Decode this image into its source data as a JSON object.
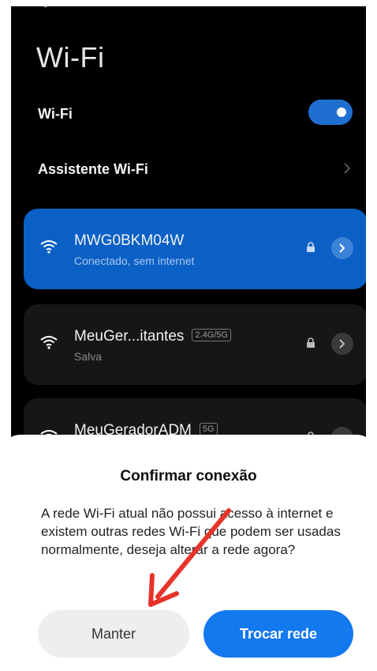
{
  "screen": {
    "title": "Wi-Fi",
    "wifi_toggle": {
      "label": "Wi-Fi",
      "state": "on"
    },
    "assistant": {
      "label": "Assistente Wi-Fi"
    },
    "networks": [
      {
        "name": "MWG0BKM04W",
        "status": "Conectado, sem internet",
        "band": "",
        "secured": true,
        "active": true
      },
      {
        "name": "MeuGer...itantes",
        "status": "Salva",
        "band": "2.4G/5G",
        "secured": true,
        "active": false
      },
      {
        "name": "MeuGeradorADM",
        "status": "",
        "band": "5G",
        "secured": true,
        "active": false
      }
    ]
  },
  "dialog": {
    "title": "Confirmar conexão",
    "message": "A rede Wi-Fi atual não possui acesso à internet e existem outras redes Wi-Fi que podem ser usadas normalmente, deseja alterar a rede agora?",
    "keep_label": "Manter",
    "switch_label": "Trocar rede"
  },
  "colors": {
    "accent": "#1478ef",
    "active_card": "#0b60c6",
    "annotation_arrow": "#e8332a"
  },
  "icons": [
    "back-arrow-icon",
    "chevron-right-icon",
    "wifi-icon",
    "lock-icon",
    "annotation-arrow"
  ]
}
